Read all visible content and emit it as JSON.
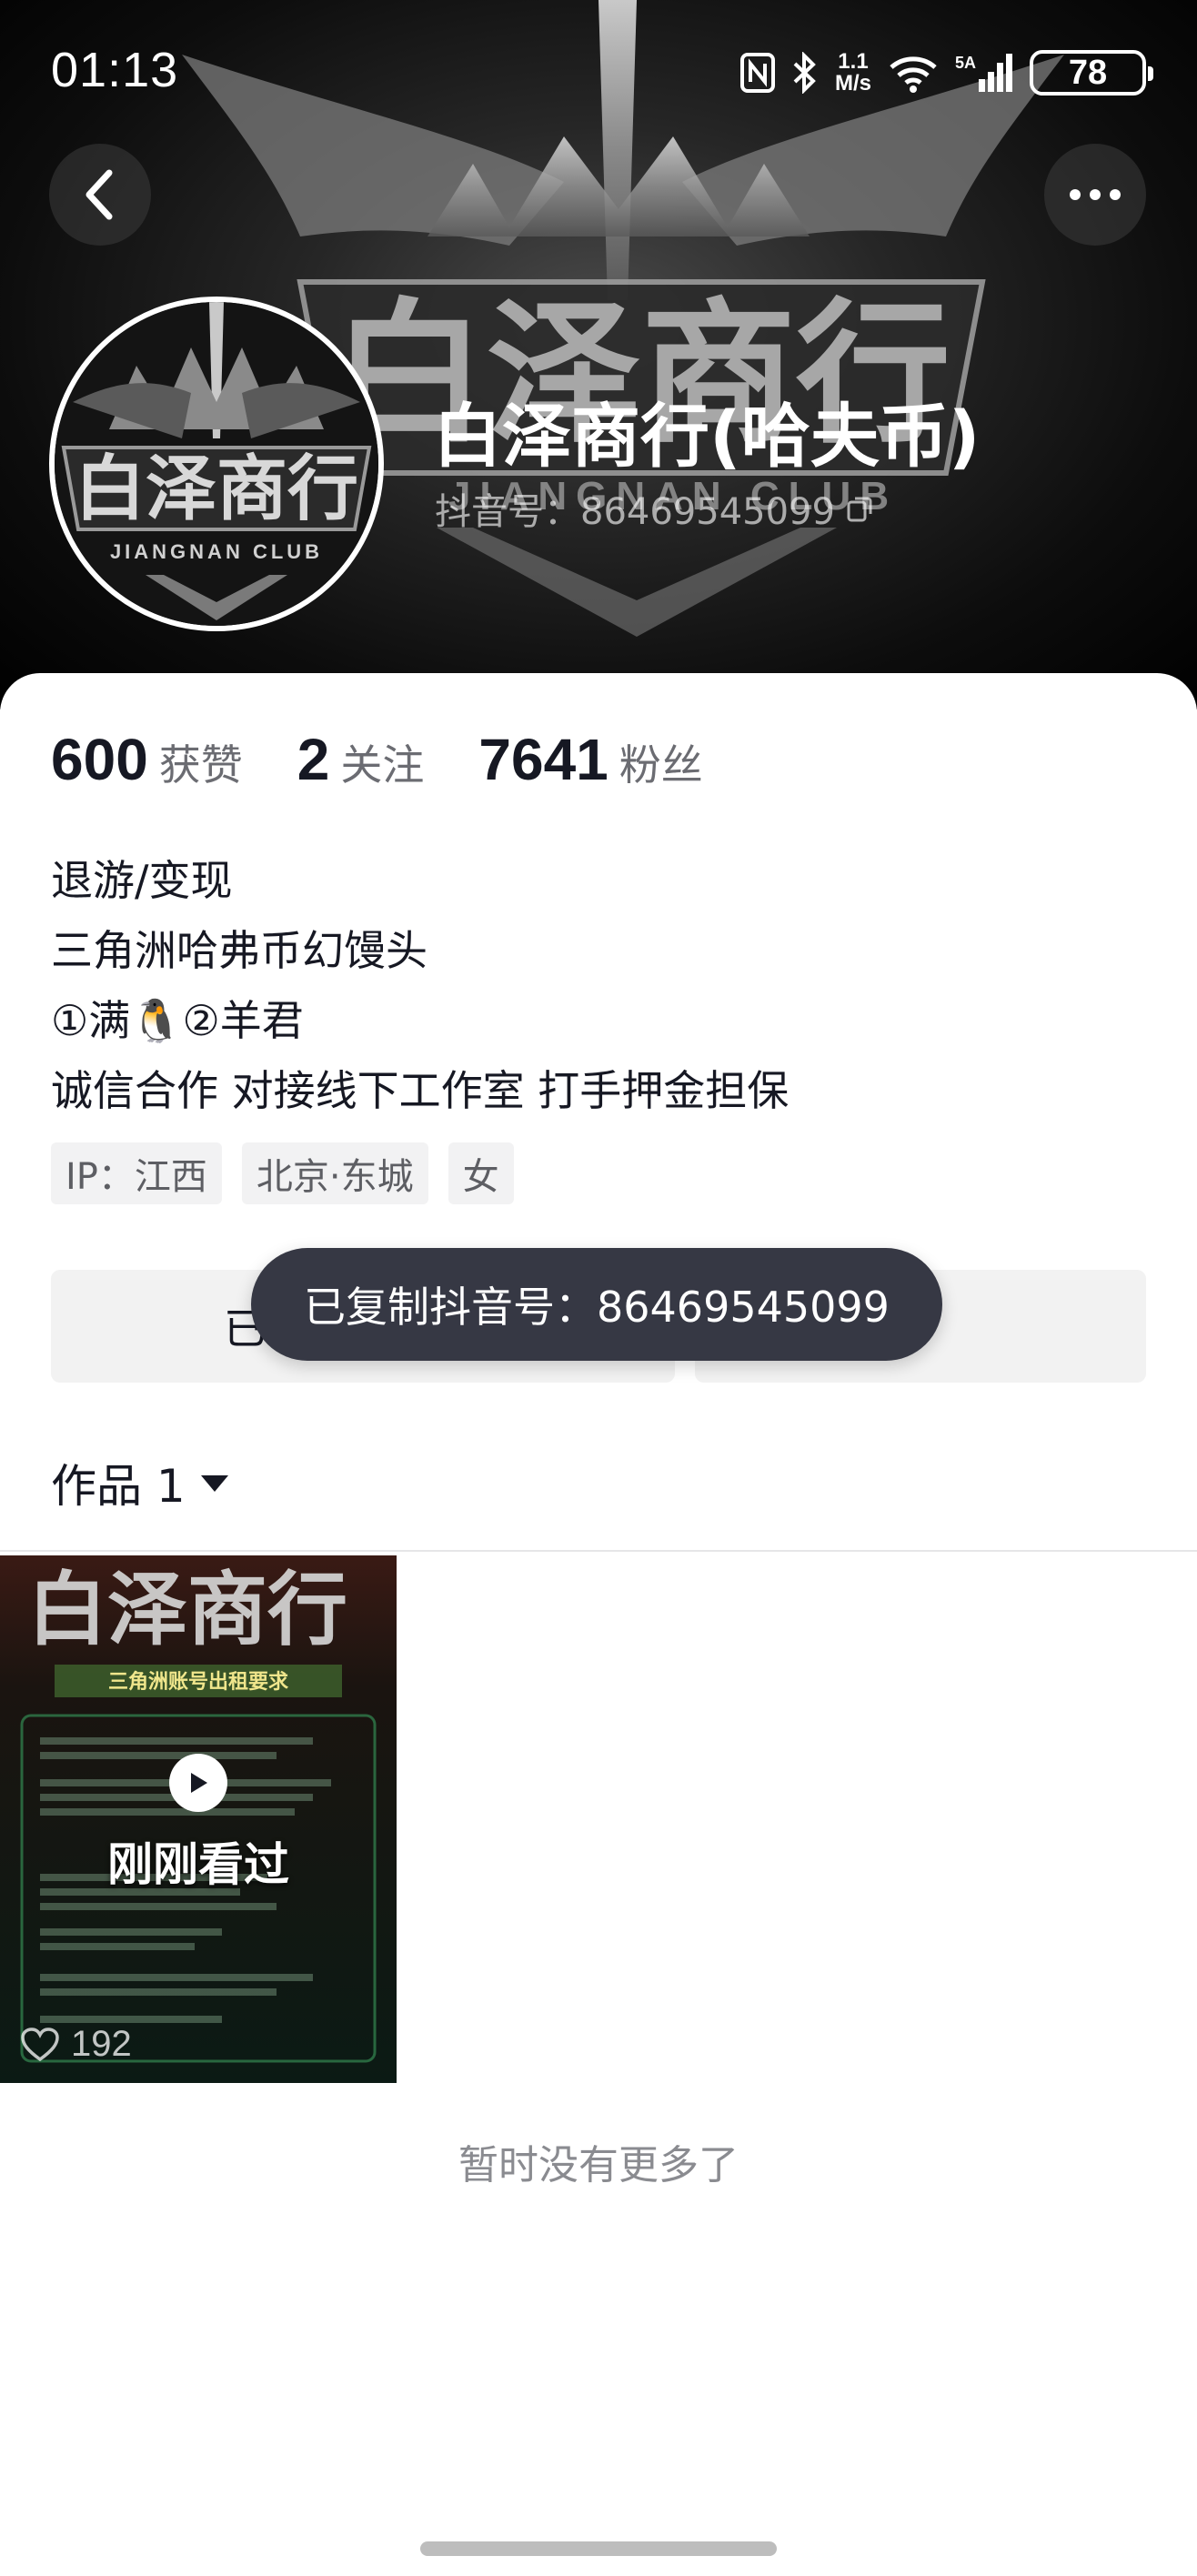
{
  "status_bar": {
    "time": "01:13",
    "speed_top": "1.1",
    "speed_bottom": "M/s",
    "signal_label": "5A",
    "battery": "78"
  },
  "header": {
    "back_icon": "chevron-left-icon",
    "more_icon": "more-dots-icon",
    "name": "白泽商行(哈夫币)",
    "douyin_id": "抖音号：86469545099",
    "copy_icon": "copy-icon",
    "banner_logo_text": "白泽商行",
    "banner_logo_sub": "JIANGNAN CLUB"
  },
  "stats": [
    {
      "num": "600",
      "label": "获赞"
    },
    {
      "num": "2",
      "label": "关注"
    },
    {
      "num": "7641",
      "label": "粉丝"
    }
  ],
  "bio": [
    "退游/变现",
    "三角洲哈弗币幻馒头",
    "①满🐧②羊君",
    "诚信合作 对接线下工作室 打手押金担保"
  ],
  "tags": [
    "IP：江西",
    "北京·东城",
    "女"
  ],
  "buttons": {
    "left_label": "已",
    "right_label": ""
  },
  "toast": "已复制抖音号：86469545099",
  "works_tab": {
    "label": "作品 1",
    "icon": "caret-down-icon"
  },
  "video": {
    "thumb_title": "白泽商行",
    "thumb_subtitle": "三角洲账号出租要求",
    "overlay_text": "刚刚看过",
    "likes": "192"
  },
  "footer_text": "暂时没有更多了",
  "colors": {
    "text_primary": "#161823",
    "text_secondary": "#6b6c72",
    "toast_bg": "#363844",
    "tag_bg": "#f2f2f3"
  }
}
